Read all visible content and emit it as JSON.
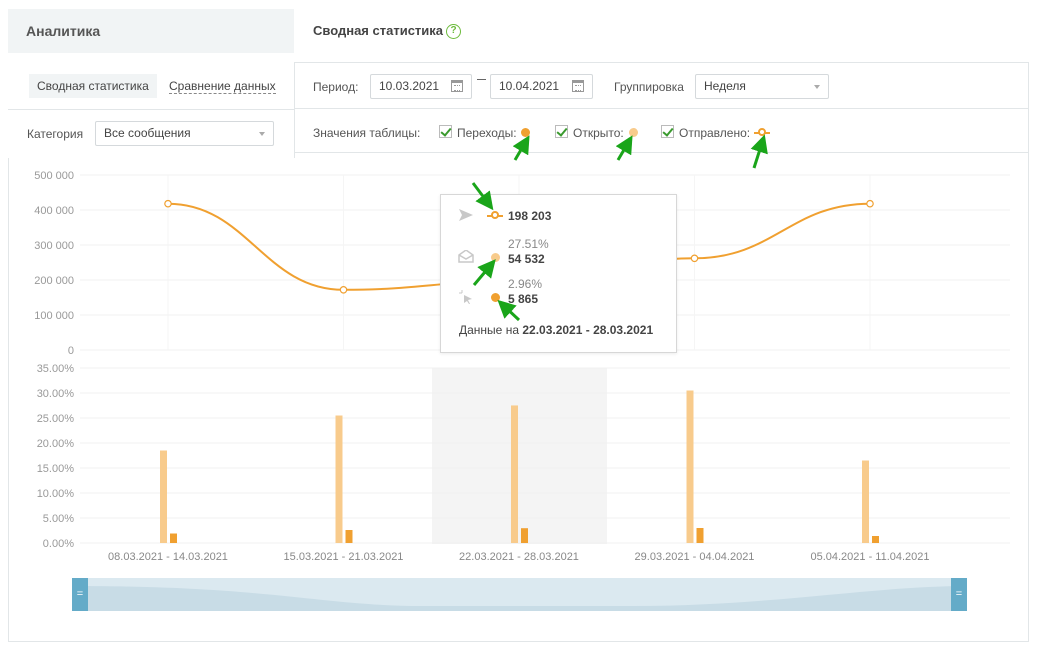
{
  "header": {
    "section_title": "Аналитика",
    "page_title": "Сводная статистика",
    "help": "?"
  },
  "left_panel": {
    "tabs": [
      {
        "label": "Сводная статистика",
        "active": true
      },
      {
        "label": "Сравнение данных",
        "active": false
      }
    ],
    "category_label": "Категория",
    "category_value": "Все сообщения"
  },
  "filters": {
    "period_label": "Период:",
    "date_from": "10.03.2021",
    "date_to": "10.04.2021",
    "grouping_label": "Группировка",
    "grouping_value": "Неделя",
    "table_values_label": "Значения таблицы:",
    "metrics": [
      {
        "label": "Переходы:",
        "checked": true,
        "color": "#f0a030",
        "marker": "dot"
      },
      {
        "label": "Открыто:",
        "checked": true,
        "color": "#f8cb8c",
        "marker": "dot"
      },
      {
        "label": "Отправлено:",
        "checked": true,
        "color": "#f0a030",
        "marker": "ring"
      }
    ]
  },
  "tooltip": {
    "sent_value": "198 203",
    "open_pct": "27.51%",
    "open_value": "54 532",
    "click_pct": "2.96%",
    "click_value": "5 865",
    "footer_prefix": "Данные на",
    "footer_range": "22.03.2021 - 28.03.2021",
    "icons": [
      "send-icon",
      "envelope-open-icon",
      "cursor-click-icon"
    ]
  },
  "colors": {
    "line": "#f0a030",
    "open_bar": "#f8cb8c",
    "click_bar": "#f0a030",
    "highlight": "#f4f4f4"
  },
  "chart_data": [
    {
      "type": "line",
      "series_key": "sent",
      "categories": [
        "08.03.2021 - 14.03.2021",
        "15.03.2021 - 21.03.2021",
        "22.03.2021 - 28.03.2021",
        "29.03.2021 - 04.04.2021",
        "05.04.2021 - 11.04.2021"
      ],
      "values": [
        418000,
        172000,
        198203,
        262000,
        418000
      ],
      "yticks": [
        "0",
        "100 000",
        "200 000",
        "300 000",
        "400 000",
        "500 000"
      ],
      "ylim": [
        0,
        500000
      ]
    },
    {
      "type": "bar",
      "categories": [
        "08.03.2021 - 14.03.2021",
        "15.03.2021 - 21.03.2021",
        "22.03.2021 - 28.03.2021",
        "29.03.2021 - 04.04.2021",
        "05.04.2021 - 11.04.2021"
      ],
      "series": [
        {
          "key": "open",
          "values": [
            18.5,
            25.5,
            27.51,
            30.5,
            16.5
          ]
        },
        {
          "key": "click",
          "values": [
            1.9,
            2.6,
            2.96,
            3.0,
            1.4
          ]
        }
      ],
      "yticks": [
        "0.00%",
        "5.00%",
        "10.00%",
        "15.00%",
        "20.00%",
        "25.00%",
        "30.00%",
        "35.00%"
      ],
      "ylim": [
        0,
        35
      ],
      "highlighted_index": 2
    }
  ]
}
